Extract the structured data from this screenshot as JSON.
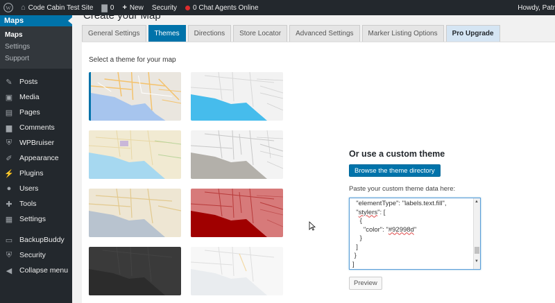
{
  "adminbar": {
    "site_name": "Code Cabin Test Site",
    "comments_count": "0",
    "new_label": "New",
    "security_label": "Security",
    "chat_label": "0 Chat Agents Online",
    "howdy": "Howdy, Patr"
  },
  "sidebar": {
    "current": "Maps",
    "submenu": [
      "Maps",
      "Settings",
      "Support"
    ],
    "items": [
      {
        "label": "Posts",
        "icon": "pin-icon"
      },
      {
        "label": "Media",
        "icon": "media-icon"
      },
      {
        "label": "Pages",
        "icon": "pages-icon"
      },
      {
        "label": "Comments",
        "icon": "comments-icon"
      },
      {
        "label": "WPBruiser",
        "icon": "shield-icon"
      },
      {
        "label": "Appearance",
        "icon": "brush-icon"
      },
      {
        "label": "Plugins",
        "icon": "plugin-icon"
      },
      {
        "label": "Users",
        "icon": "users-icon"
      },
      {
        "label": "Tools",
        "icon": "wrench-icon"
      },
      {
        "label": "Settings",
        "icon": "settings-icon"
      },
      {
        "label": "BackupBuddy",
        "icon": "backup-icon"
      },
      {
        "label": "Security",
        "icon": "lock-icon"
      },
      {
        "label": "Collapse menu",
        "icon": "collapse-icon"
      }
    ]
  },
  "page": {
    "title": "Create your Map"
  },
  "tabs": [
    "General Settings",
    "Themes",
    "Directions",
    "Store Locator",
    "Advanced Settings",
    "Marker Listing Options",
    "Pro Upgrade"
  ],
  "themes": {
    "label": "Select a theme for your map"
  },
  "custom": {
    "heading": "Or use a custom theme",
    "browse_label": "Browse the theme directory",
    "paste_label": "Paste your custom theme data here:",
    "code": {
      "l1": "\"elementType\": \"labels.text.fill\",",
      "l2a": "\"",
      "l2b": "stylers",
      "l2c": "\": [",
      "l3": "{",
      "l4a": "\"color\": \"",
      "l4b": "#92998d",
      "l4c": "\"",
      "l5": "}",
      "l6": "]",
      "l7": "}",
      "l8": "]"
    },
    "preview_label": "Preview"
  },
  "colors": {
    "accent": "#0073aa",
    "sidebar_bg": "#23282d",
    "theme_red": "#a00000"
  }
}
